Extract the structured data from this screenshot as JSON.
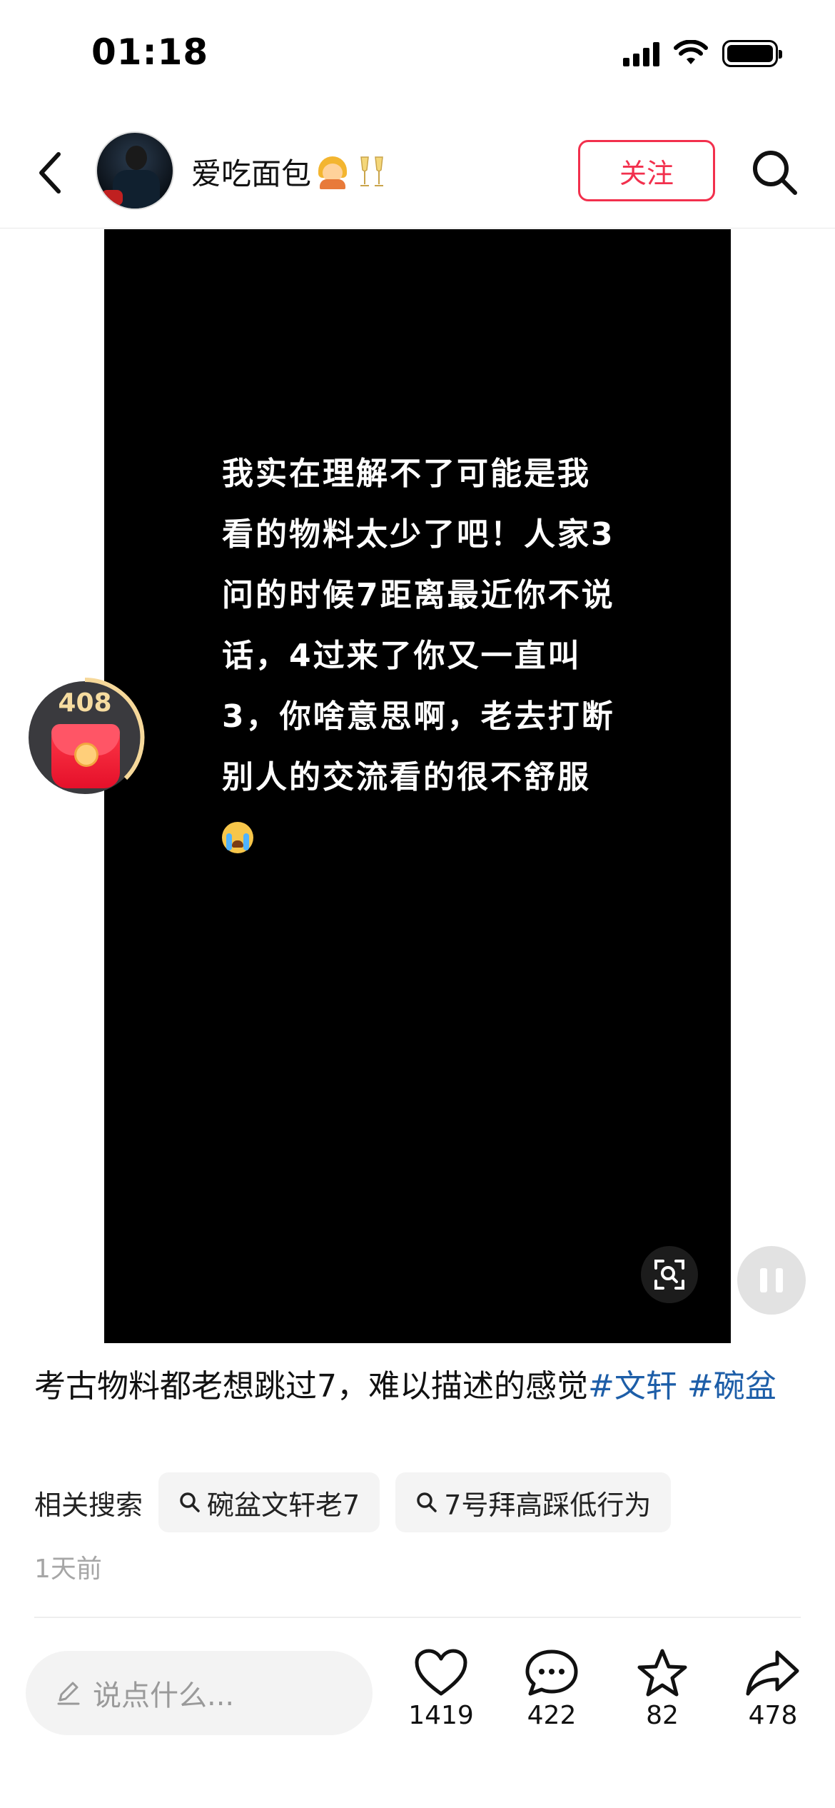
{
  "status_bar": {
    "time": "01:18"
  },
  "header": {
    "username": "爱吃面包",
    "follow_label": "关注"
  },
  "video": {
    "overlay_text": "我实在理解不了可能是我看的物料太少了吧！人家3问的时候7距离最近你不说话，4过来了你又一直叫3，你啥意思啊，老去打断别人的交流看的很不舒服",
    "red_packet_count": "408"
  },
  "post": {
    "caption": "考古物料都老想跳过7，难以描述的感觉",
    "hashtags": [
      "#文轩",
      "#碗盆"
    ],
    "related_label": "相关搜索",
    "related_searches": [
      "碗盆文轩老7",
      "7号拜高踩低行为"
    ],
    "time_ago": "1天前"
  },
  "bottom_bar": {
    "comment_placeholder": "说点什么...",
    "likes": "1419",
    "comments": "422",
    "favorites": "82",
    "shares": "478"
  },
  "icons": [
    "back-icon",
    "search-icon",
    "scan-icon",
    "pause-icon",
    "pencil-icon",
    "heart-icon",
    "comment-icon",
    "star-icon",
    "share-icon"
  ],
  "colors": {
    "accent": "#f2304d",
    "hashtag": "#1d5ea8",
    "video_bg": "#000000"
  }
}
